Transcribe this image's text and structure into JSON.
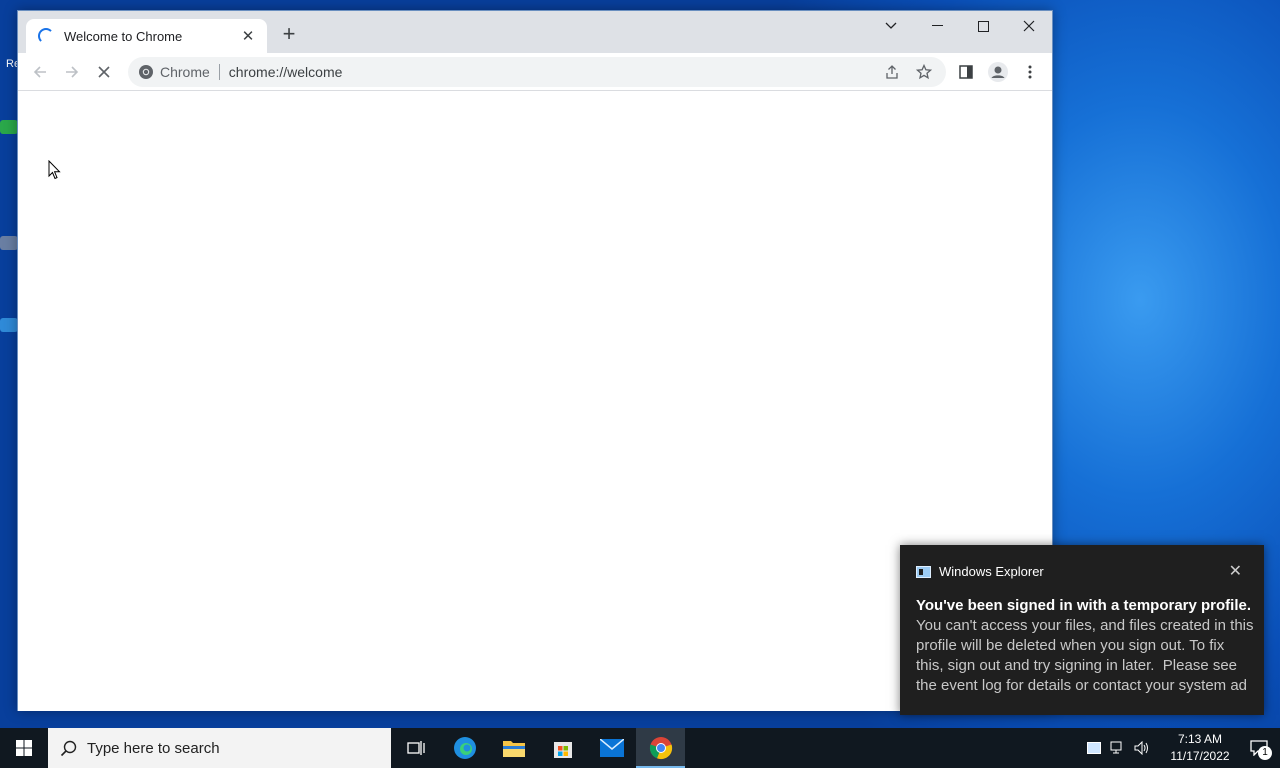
{
  "browser": {
    "tab_title": "Welcome to Chrome",
    "site_chip_label": "Chrome",
    "url": "chrome://welcome"
  },
  "notification": {
    "app_name": "Windows Explorer",
    "title": "You've been signed in with a temporary profile.",
    "body": "You can't access your files, and files created in this\nprofile will be deleted when you sign out. To fix\nthis, sign out and try signing in later.  Please see\nthe event log for details or contact your system ad"
  },
  "taskbar": {
    "search_placeholder": "Type here to search",
    "time": "7:13 AM",
    "date": "11/17/2022",
    "notification_count": "1"
  },
  "colors": {
    "accent": "#1a73e8",
    "desktop": "#0b56c2",
    "taskbar": "#101820"
  }
}
